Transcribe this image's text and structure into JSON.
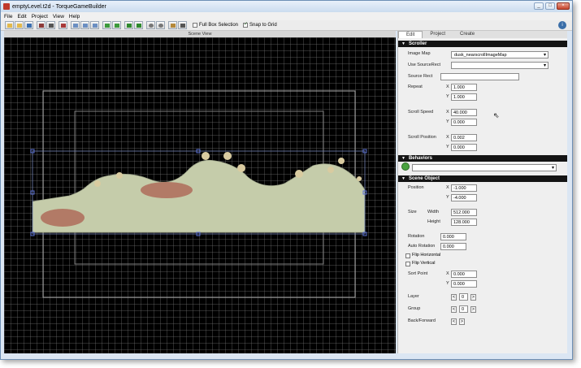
{
  "window": {
    "title": "emptyLevel.t2d - TorqueGameBuilder",
    "controls": [
      "minimize-icon",
      "maximize-icon",
      "close-icon"
    ]
  },
  "menu": [
    "File",
    "Edit",
    "Project",
    "View",
    "Help"
  ],
  "toolbar": {
    "full_box_selection": "Full Box Selection",
    "full_box_selection_checked": false,
    "snap_to_grid": "Snap to Grid",
    "snap_to_grid_checked": true,
    "info": "i"
  },
  "scene": {
    "header": "Scene View"
  },
  "panel": {
    "tabs": [
      "Edit",
      "Project",
      "Create"
    ],
    "active_tab": "Edit",
    "scroller": {
      "title": "Scroller",
      "image_map_label": "Image Map",
      "image_map_value": "dusk_nearscrollImageMap",
      "use_source_rect_label": "Use SourceRect",
      "use_source_rect_value": "",
      "source_rect_label": "Source Rect",
      "source_rect_value": "",
      "repeat_label": "Repeat",
      "repeat_x": "1.000",
      "repeat_y": "1.000",
      "scroll_speed_label": "Scroll Speed",
      "scroll_speed_x": "40.000",
      "scroll_speed_y": "0.000",
      "scroll_position_label": "Scroll Position",
      "scroll_position_x": "0.002",
      "scroll_position_y": "0.000",
      "x_label": "X",
      "y_label": "Y"
    },
    "behaviors": {
      "title": "Behaviors",
      "select_value": ""
    },
    "scene_object": {
      "title": "Scene Object",
      "position_label": "Position",
      "position_x": "-1.000",
      "position_y": "-4.000",
      "size_label": "Size",
      "width_label": "Width",
      "width_value": "512.000",
      "height_label": "Height",
      "height_value": "128.000",
      "rotation_label": "Rotation",
      "rotation_value": "0.000",
      "auto_rotation_label": "Auto Rotation",
      "auto_rotation_value": "0.000",
      "flip_horizontal_label": "Flip Horizontal",
      "flip_vertical_label": "Flip Vertical",
      "sort_point_label": "Sort Point",
      "sort_x": "0.000",
      "sort_y": "0.000",
      "layer_label": "Layer",
      "layer_value": "0",
      "group_label": "Group",
      "group_value": "0",
      "back_forward_label": "Back/Forward",
      "x_label": "X",
      "y_label": "Y",
      "dec": "<",
      "inc": ">"
    }
  }
}
